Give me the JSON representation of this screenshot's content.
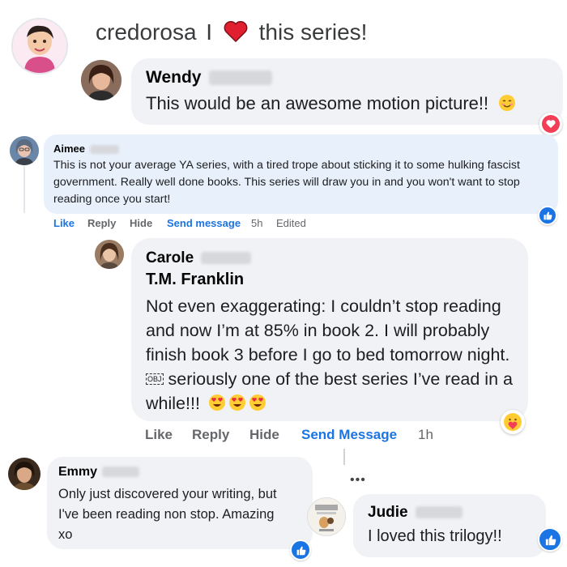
{
  "header": {
    "username": "credorosa",
    "separator": "I",
    "text": "this series!",
    "heart_color": "#e0202e"
  },
  "wendy": {
    "name": "Wendy",
    "text": "This would be an awesome motion picture!!"
  },
  "aimee": {
    "name": "Aimee",
    "text": "This is not your average YA series, with a tired trope about sticking it to some hulking fascist government. Really well done books. This series will draw you in and you won't want to stop reading once you start!",
    "actions": {
      "like": "Like",
      "reply": "Reply",
      "hide": "Hide",
      "send": "Send message",
      "time": "5h",
      "edited": "Edited"
    }
  },
  "carole": {
    "name": "Carole",
    "tag": "T.M. Franklin",
    "text_before": "Not even exaggerating: I couldn’t stop reading and now I’m at 85% in book 2. I will probably finish book 3 before I go to bed tomorrow night.",
    "obj_glyph": "OBJ",
    "text_after": "seriously one of the best series I’ve read in a while!!!",
    "actions": {
      "like": "Like",
      "reply": "Reply",
      "hide": "Hide",
      "send": "Send Message",
      "time": "1h"
    }
  },
  "emmy": {
    "name": "Emmy",
    "text": "Only just discovered your writing, but I've been reading non stop. Amazing xo"
  },
  "judie": {
    "name": "Judie",
    "text": "I loved this trilogy!!"
  },
  "colors": {
    "bubble": "#f0f2f5",
    "link_blue": "#1b74e4",
    "muted": "#65676b",
    "aimee_bubble": "#e8f1fb"
  }
}
